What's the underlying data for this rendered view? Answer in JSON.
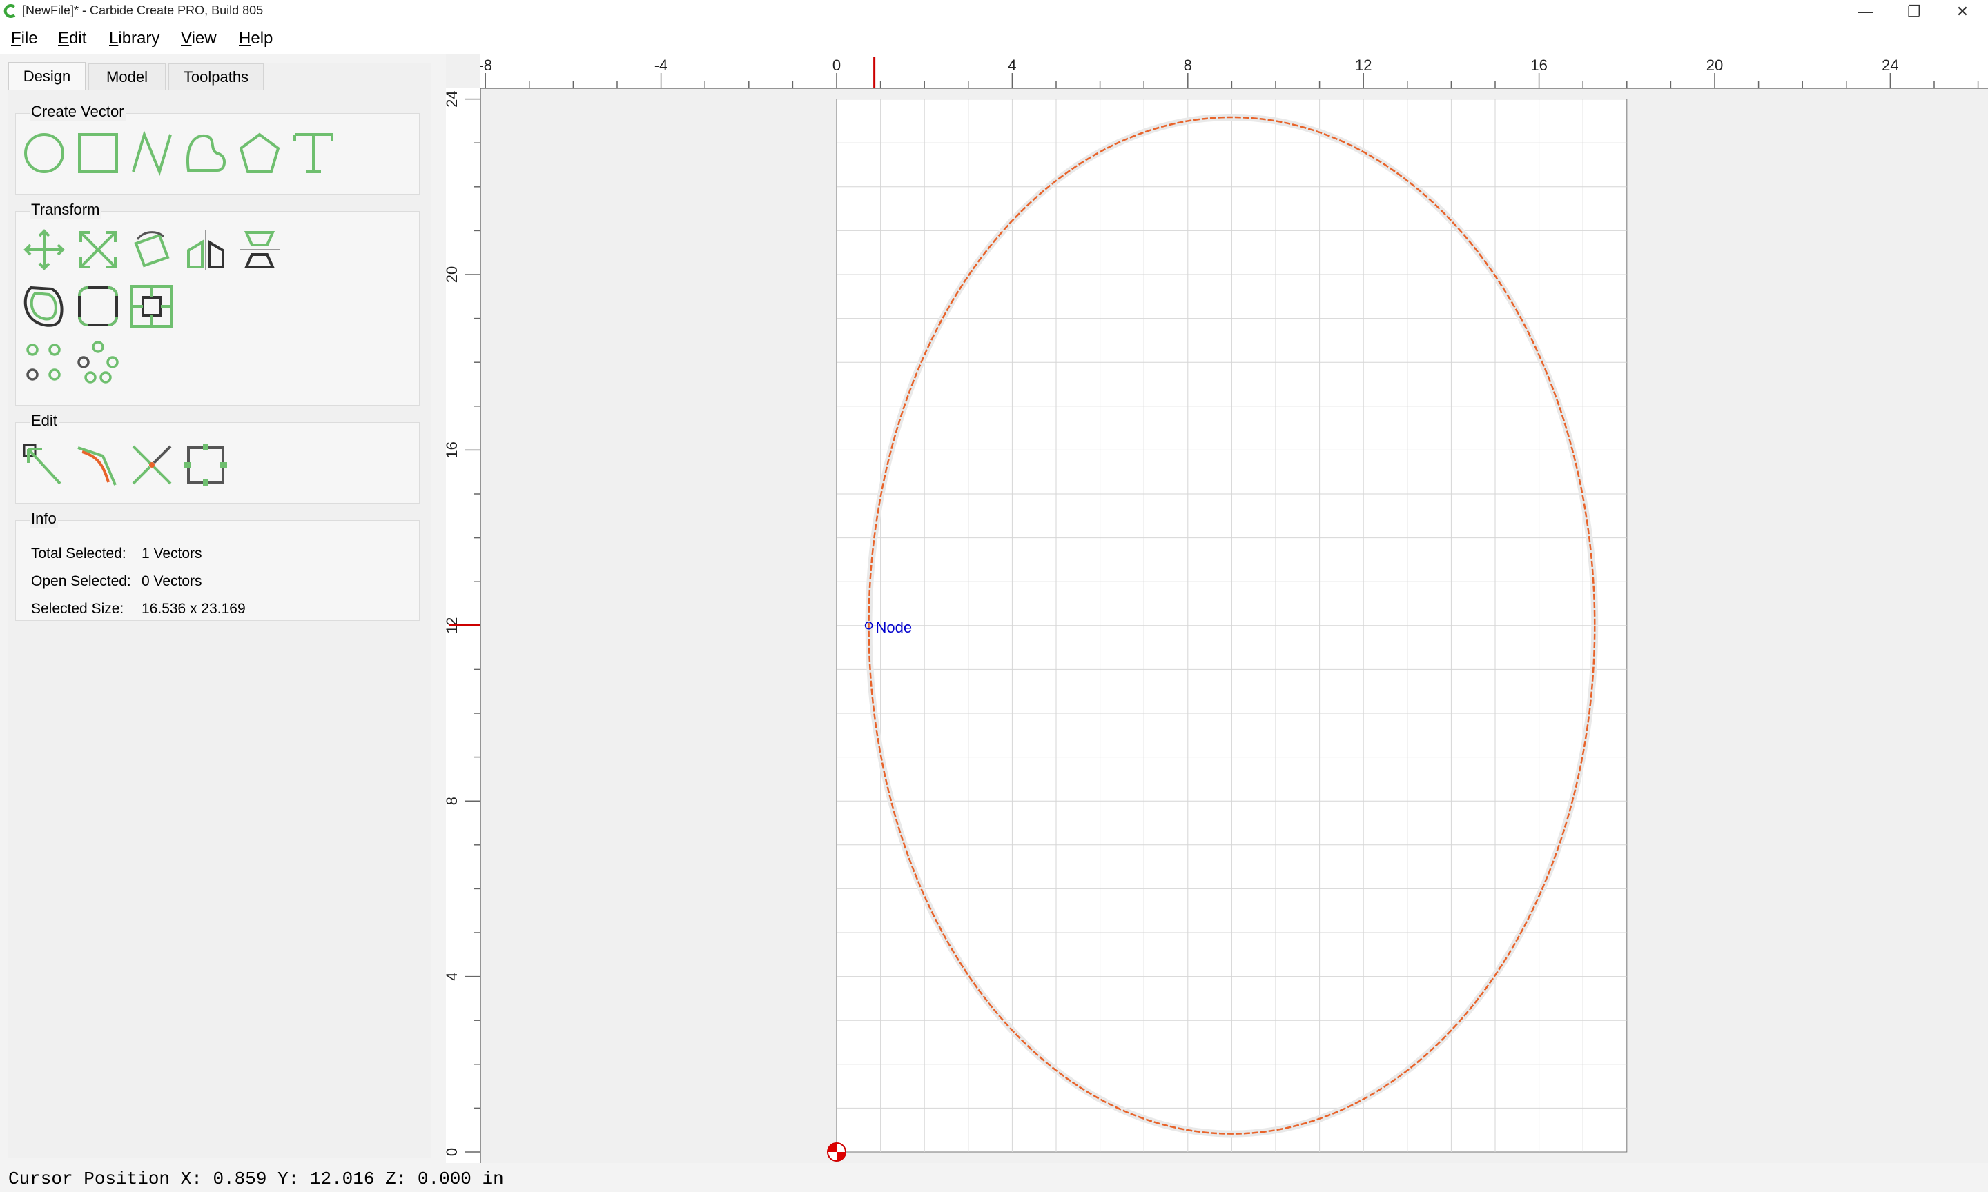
{
  "window": {
    "title": "[NewFile]* - Carbide Create PRO, Build 805",
    "minimize": "—",
    "restore": "❐",
    "close": "✕"
  },
  "menu": [
    {
      "label": "File"
    },
    {
      "label": "Edit"
    },
    {
      "label": "Library"
    },
    {
      "label": "View"
    },
    {
      "label": "Help"
    }
  ],
  "tabs": [
    {
      "label": "Design",
      "active": true
    },
    {
      "label": "Model",
      "active": false
    },
    {
      "label": "Toolpaths",
      "active": false
    }
  ],
  "create_vector": {
    "title": "Create Vector",
    "tools": [
      "circle-icon",
      "rectangle-icon",
      "polyline-icon",
      "curve-icon",
      "polygon-icon",
      "text-icon"
    ]
  },
  "transform": {
    "title": "Transform",
    "tools": [
      "move-icon",
      "scale-icon",
      "rotate-icon",
      "mirror-icon",
      "align-icon",
      "offset-icon",
      "fillet-icon",
      "boolean-icon",
      "grid-array-icon",
      "circular-array-icon"
    ]
  },
  "edit": {
    "title": "Edit",
    "tools": [
      "node-edit-icon",
      "trim-icon",
      "cut-icon",
      "join-icon"
    ]
  },
  "info": {
    "title": "Info",
    "total_selected_label": "Total Selected:",
    "total_selected_value": "1 Vectors",
    "open_selected_label": "Open Selected:",
    "open_selected_value": "0 Vectors",
    "selected_size_label": "Selected Size:",
    "selected_size_value": "16.536 x 23.169"
  },
  "rulers": {
    "x_labels": [
      "-8",
      "-4",
      "0",
      "4",
      "8",
      "12",
      "16",
      "20",
      "24"
    ],
    "y_labels": [
      "24",
      "20",
      "16",
      "12",
      "8",
      "4",
      "0"
    ]
  },
  "canvas": {
    "stock_width": 18,
    "stock_height": 24,
    "ellipse": {
      "cx": 9.0,
      "cy": 12.0,
      "rx": 8.268,
      "ry": 11.585
    },
    "node_label": "Node",
    "node": {
      "x": 0.732,
      "y": 12.0
    },
    "cursor_marker": {
      "x": 0.859,
      "y": 12.016
    },
    "accent_color": "#e8632a",
    "node_color": "#0000cc"
  },
  "status": {
    "text": "Cursor Position X: 0.859 Y: 12.016 Z: 0.000 in"
  }
}
